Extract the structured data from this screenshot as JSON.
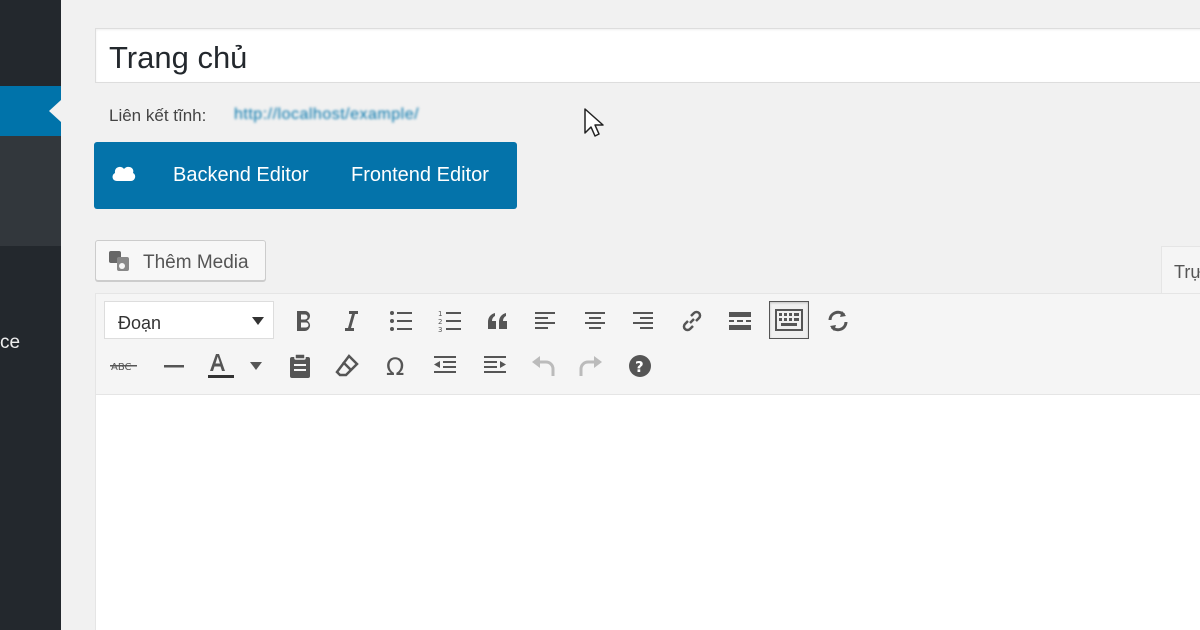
{
  "sidebar": {
    "partial_label": "ce"
  },
  "post": {
    "title": "Trang chủ",
    "permalink_label": "Liên kết tĩnh:",
    "permalink_url": "http://localhost/example/"
  },
  "composer": {
    "backend_label": "Backend Editor",
    "frontend_label": "Frontend Editor"
  },
  "media": {
    "add_label": "Thêm Media"
  },
  "editor": {
    "tab_visual": "Trực quan",
    "format_value": "Đoạn"
  },
  "colors": {
    "accent": "#0073aa",
    "sidebar": "#23282d"
  }
}
